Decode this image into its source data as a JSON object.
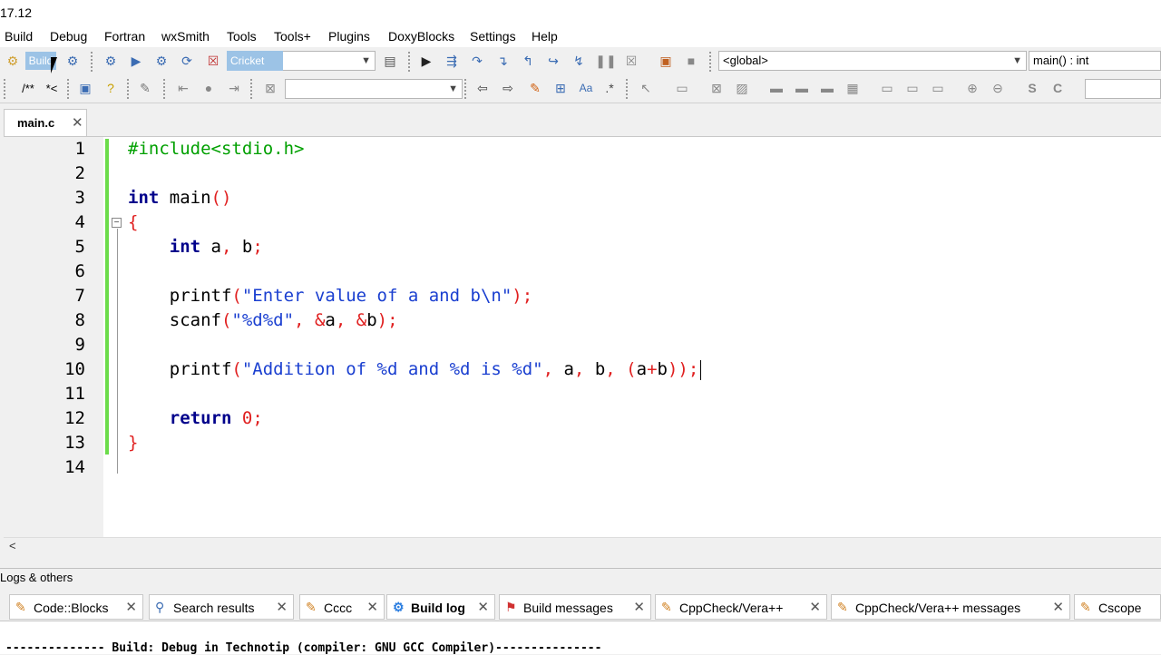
{
  "title": "17.12",
  "menu": [
    "Build",
    "Debug",
    "Fortran",
    "wxSmith",
    "Tools",
    "Tools+",
    "Plugins",
    "DoxyBlocks",
    "Settings",
    "Help"
  ],
  "toolbar": {
    "build_label": "Build",
    "target_value": "Cricket",
    "scope_value": "<global>",
    "function_value": "main() : int",
    "comment_label": "/**",
    "uncomment_label": "*<"
  },
  "editor": {
    "tab_name": "main.c",
    "line_numbers": [
      "1",
      "2",
      "3",
      "4",
      "5",
      "6",
      "7",
      "8",
      "9",
      "10",
      "11",
      "12",
      "13",
      "14"
    ]
  },
  "logs": {
    "header": "Logs & others",
    "tabs": [
      {
        "label": "Code::Blocks",
        "icon": "document-icon"
      },
      {
        "label": "Search results",
        "icon": "search-icon"
      },
      {
        "label": "Cccc",
        "icon": "document-icon"
      },
      {
        "label": "Build log",
        "icon": "gear-icon"
      },
      {
        "label": "Build messages",
        "icon": "flag-icon"
      },
      {
        "label": "CppCheck/Vera++",
        "icon": "document-icon"
      },
      {
        "label": "CppCheck/Vera++ messages",
        "icon": "document-icon"
      },
      {
        "label": "Cscope",
        "icon": "document-icon"
      }
    ],
    "log_line": "-------------- Build: Debug in Technotip (compiler: GNU GCC Compiler)---------------"
  },
  "colors": {
    "change_bar": "#6bdc4a",
    "keyword": "#00008b",
    "string": "#1a3fd0",
    "preprocessor": "#00a000",
    "operator": "#e02020"
  }
}
